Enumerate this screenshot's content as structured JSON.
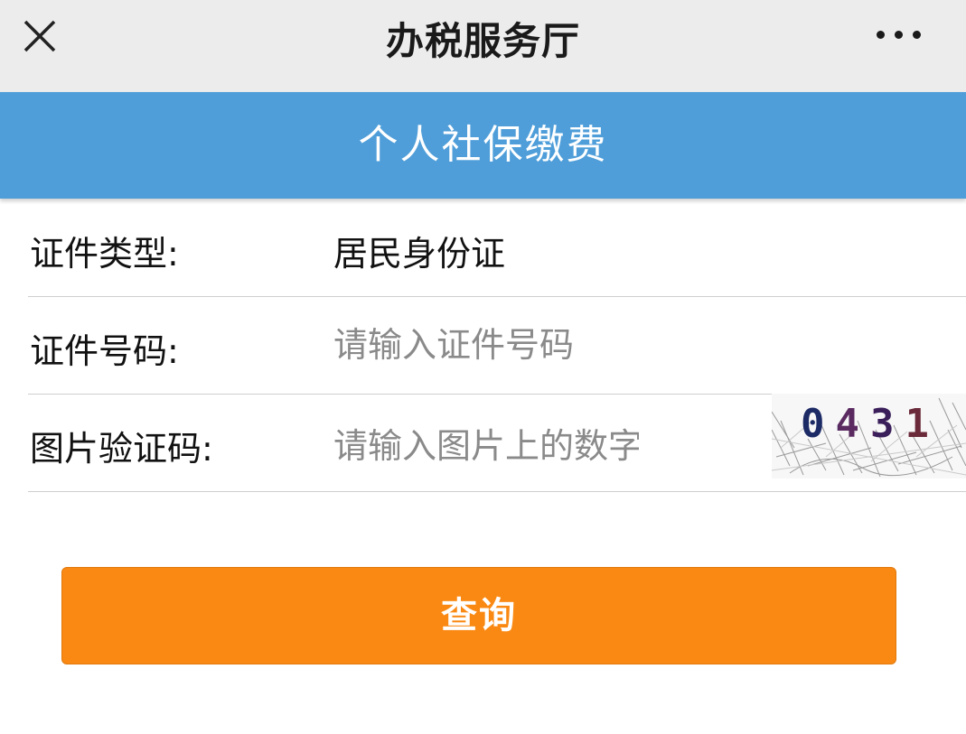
{
  "header": {
    "title": "办税服务厅",
    "close_icon": "close-icon",
    "more_icon": "more-horizontal-icon"
  },
  "banner": {
    "title": "个人社保缴费",
    "color": "#4f9ed9"
  },
  "form": {
    "id_type": {
      "label": "证件类型:",
      "value": "居民身份证"
    },
    "id_number": {
      "label": "证件号码:",
      "placeholder": "请输入证件号码",
      "value": ""
    },
    "captcha": {
      "label": "图片验证码:",
      "placeholder": "请输入图片上的数字",
      "value": "",
      "image_text": "0431"
    }
  },
  "actions": {
    "query_label": "查询",
    "query_color": "#fa8913"
  }
}
